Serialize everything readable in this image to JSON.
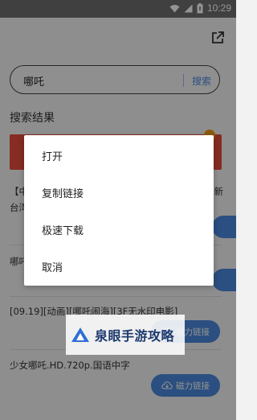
{
  "status_bar": {
    "time": "10:29",
    "icons": [
      "wifi-icon",
      "signal-icon",
      "battery-icon"
    ]
  },
  "toolbar": {
    "share_icon": "share-icon"
  },
  "search": {
    "query": "哪吒",
    "button_label": "搜索"
  },
  "results": {
    "title": "搜索结果",
    "items": [
      {
        "text_left": "【中",
        "text_right": "新",
        "text_line2": "台湾"
      },
      {
        "text_left": "哪吒"
      },
      {
        "text": "[09.19][动画][哪吒闹海][3F无水印电影]"
      },
      {
        "text": "少女哪吒.HD.720p.国语中字"
      }
    ],
    "magnet_label": "磁力链接"
  },
  "context_menu": {
    "items": [
      "打开",
      "复制链接",
      "极速下载",
      "取消"
    ]
  },
  "watermark": {
    "text": "泉眼手游攻略"
  },
  "colors": {
    "accent": "#4a89dc",
    "banner": "#e74c3c",
    "status_bar": "#6f6f6f"
  }
}
